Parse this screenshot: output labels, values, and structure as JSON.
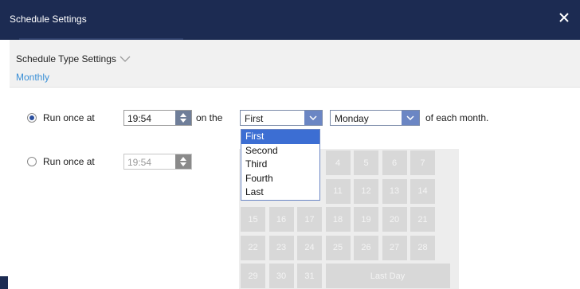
{
  "window": {
    "title": "Schedule Settings",
    "close_icon": "close-icon"
  },
  "schedule_type": {
    "heading": "Schedule Type Settings",
    "value": "Monthly"
  },
  "rule1": {
    "label": "Run once at",
    "time": "19:54",
    "on_the": "on the",
    "ordinal": "First",
    "weekday": "Monday",
    "suffix": "of each month.",
    "selected": true
  },
  "ordinal_options": [
    "First",
    "Second",
    "Third",
    "Fourth",
    "Last"
  ],
  "rule2": {
    "label": "Run once at",
    "time": "19:54",
    "selected": false
  },
  "calendar": {
    "days": [
      "4",
      "5",
      "6",
      "7",
      "11",
      "12",
      "13",
      "14",
      "15",
      "16",
      "17",
      "18",
      "19",
      "20",
      "21",
      "22",
      "23",
      "24",
      "25",
      "26",
      "27",
      "28",
      "29",
      "30",
      "31"
    ],
    "last_day": "Last Day"
  },
  "colors": {
    "titlebar": "#1c2b52",
    "accent": "#3a8fd6",
    "dropdown_highlight": "#3c6ed3"
  }
}
